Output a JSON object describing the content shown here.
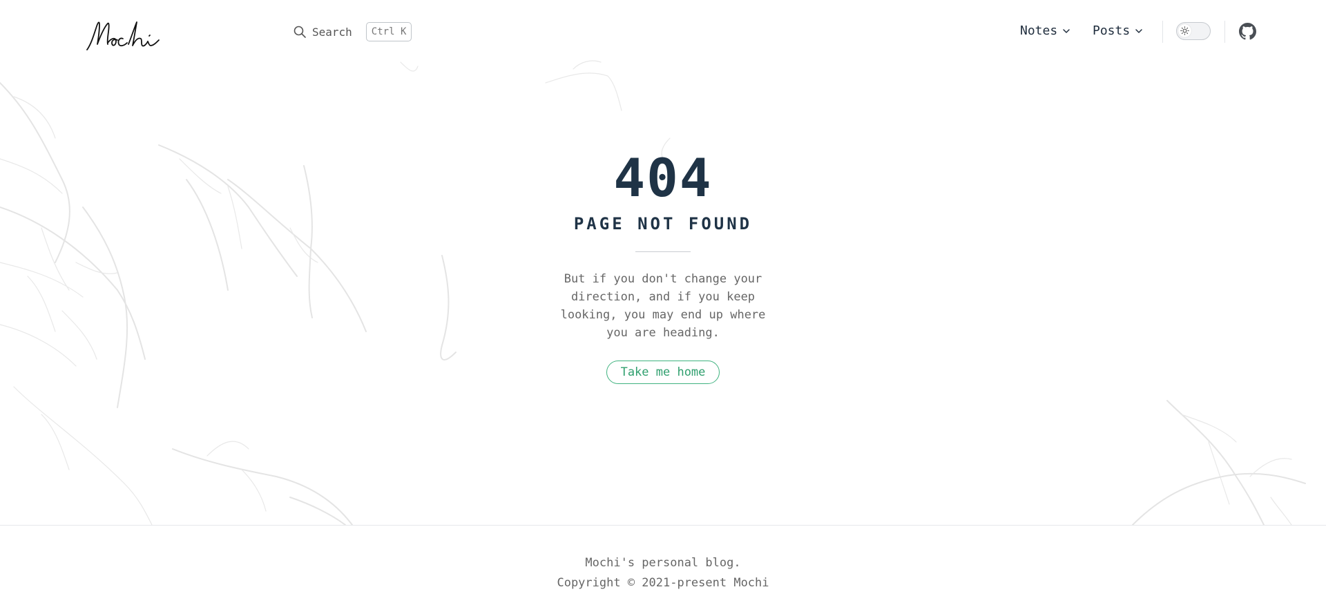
{
  "header": {
    "search_label": "Search",
    "search_shortcut": "Ctrl K",
    "nav": [
      {
        "label": "Notes"
      },
      {
        "label": "Posts"
      }
    ],
    "theme_mode": "light"
  },
  "icons": {
    "search": "search-icon",
    "chevron": "chevron-down-icon",
    "theme": "sun-icon",
    "github": "github-icon",
    "logo": "mochi-signature-logo"
  },
  "main": {
    "code": "404",
    "title": "PAGE NOT FOUND",
    "message": "But if you don't change your direction, and if you keep looking, you may end up where you are heading.",
    "home_button": "Take me home"
  },
  "footer": {
    "line1": "Mochi's personal blog.",
    "line2": "Copyright © 2021-present Mochi"
  },
  "colors": {
    "accent": "#3fb27f",
    "heading": "#1f3346",
    "text_muted": "#666666",
    "background": "#ffffff"
  }
}
